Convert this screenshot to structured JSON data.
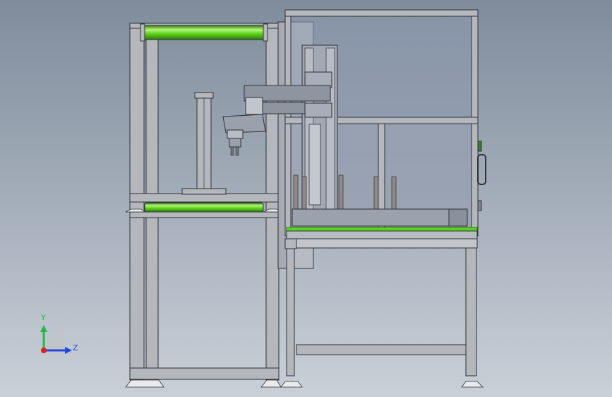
{
  "view": {
    "background_top": "#7f8c9c",
    "background_bottom": "#c9d0d8"
  },
  "colors": {
    "frame_fill": "#b4b8bd",
    "frame_stroke": "#2e3135",
    "roller_green": "#5ad41c",
    "roller_dark": "#2f7a0a",
    "roller_light": "#b6f57a",
    "panel_gray": "#9ea4b3",
    "panel_dark": "#6f7582",
    "glass": "#8e9bb0",
    "axis_x": "#e0201c",
    "axis_y": "#1fb84a",
    "axis_z": "#2347e0"
  },
  "triad": {
    "y_label": "Y",
    "z_label": "Z"
  }
}
